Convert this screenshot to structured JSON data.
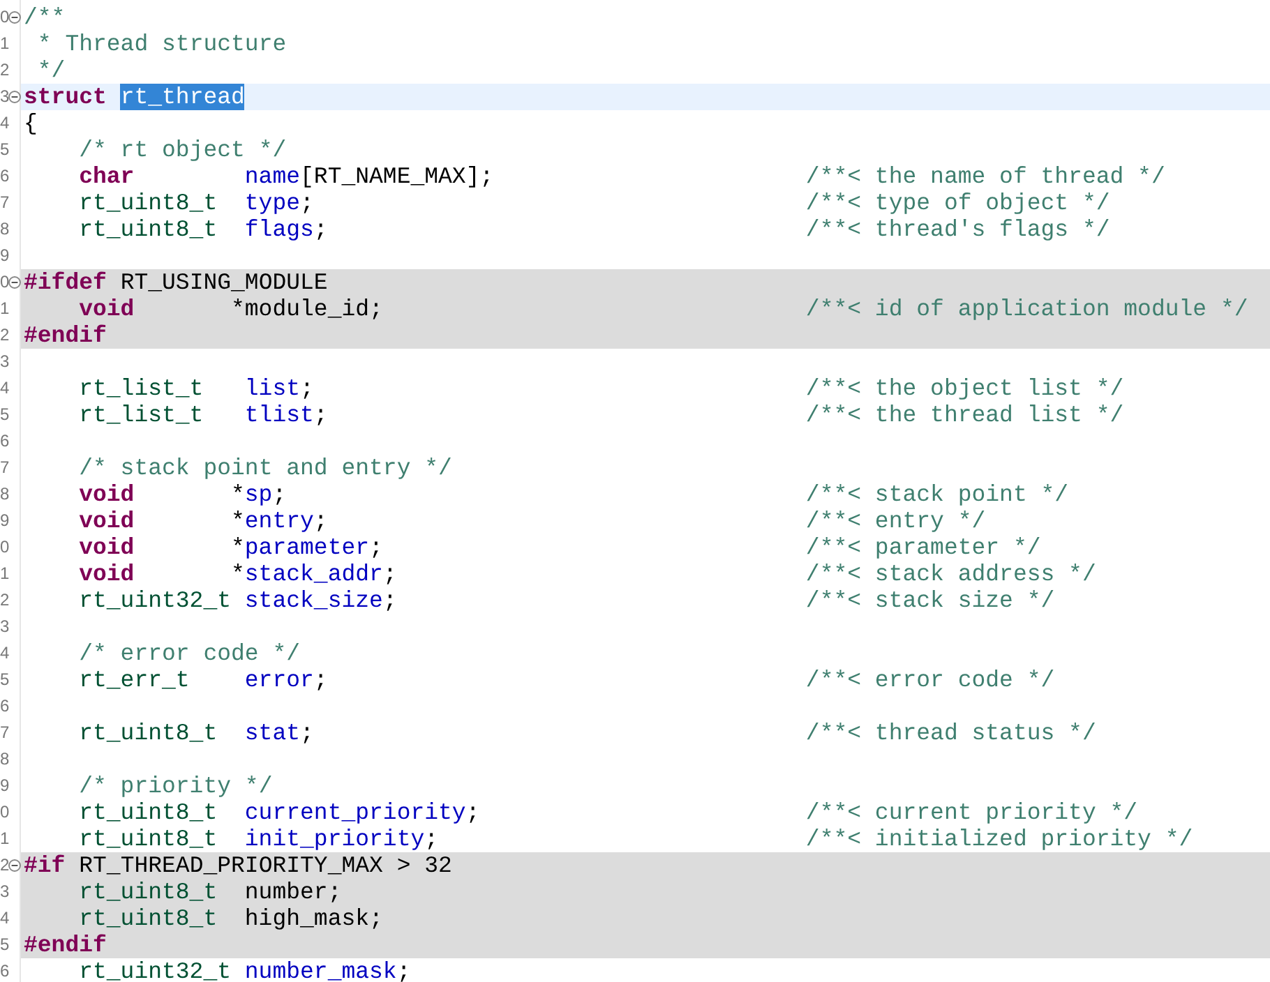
{
  "editor": {
    "lines": [
      {
        "number": "0",
        "kind": "code",
        "indent": false,
        "fold": true,
        "inactive": false,
        "current": false,
        "tokens": [
          {
            "kind": "comment",
            "text": "/**"
          }
        ]
      },
      {
        "number": "1",
        "kind": "code",
        "indent": false,
        "fold": false,
        "inactive": false,
        "current": false,
        "tokens": [
          {
            "kind": "comment",
            "text": " * Thread structure"
          }
        ]
      },
      {
        "number": "2",
        "kind": "code",
        "indent": false,
        "fold": false,
        "inactive": false,
        "current": false,
        "tokens": [
          {
            "kind": "comment",
            "text": " */"
          }
        ]
      },
      {
        "number": "3",
        "kind": "code",
        "indent": false,
        "fold": true,
        "inactive": false,
        "current": true,
        "tokens": [
          {
            "kind": "keyword",
            "text": "struct"
          },
          {
            "kind": "plain",
            "text": "rt_thread",
            "selected": true
          }
        ]
      },
      {
        "number": "4",
        "kind": "code",
        "indent": false,
        "fold": false,
        "inactive": false,
        "current": false,
        "tokens": [
          {
            "kind": "plain",
            "text": "{"
          }
        ]
      },
      {
        "number": "5",
        "kind": "code",
        "indent": true,
        "fold": false,
        "inactive": false,
        "current": false,
        "tokens": [
          {
            "kind": "comment",
            "text": "/* rt object */"
          }
        ]
      },
      {
        "number": "6",
        "kind": "decl",
        "indent": true,
        "fold": false,
        "inactive": false,
        "current": false,
        "tokens": [
          {
            "kind": "keyword",
            "text": "char"
          },
          {
            "kind": "field",
            "text": "name"
          },
          {
            "kind": "punct",
            "text": "[RT_NAME_MAX];"
          }
        ],
        "note": "/**< the name of thread */"
      },
      {
        "number": "7",
        "kind": "decl",
        "indent": true,
        "fold": false,
        "inactive": false,
        "current": false,
        "tokens": [
          {
            "kind": "type",
            "text": "rt_uint8_t"
          },
          {
            "kind": "field",
            "text": "type"
          },
          {
            "kind": "punct",
            "text": ";"
          }
        ],
        "note": "/**< type of object */"
      },
      {
        "number": "8",
        "kind": "decl",
        "indent": true,
        "fold": false,
        "inactive": false,
        "current": false,
        "tokens": [
          {
            "kind": "type",
            "text": "rt_uint8_t"
          },
          {
            "kind": "field",
            "text": "flags"
          },
          {
            "kind": "punct",
            "text": ";"
          }
        ],
        "note": "/**< thread's flags */"
      },
      {
        "number": "9",
        "kind": "blank",
        "fold": false,
        "inactive": false,
        "current": false
      },
      {
        "number": "0",
        "kind": "code",
        "indent": false,
        "fold": true,
        "inactive": true,
        "current": false,
        "tokens": [
          {
            "kind": "keyword",
            "text": "#ifdef"
          },
          {
            "kind": "plain",
            "text": "RT_USING_MODULE"
          }
        ]
      },
      {
        "number": "1",
        "kind": "decl",
        "indent": true,
        "fold": false,
        "inactive": true,
        "current": false,
        "tokens": [
          {
            "kind": "keyword",
            "text": "void"
          },
          {
            "kind": "ptr",
            "text": "*"
          },
          {
            "kind": "plain",
            "text": "module_id"
          },
          {
            "kind": "punct",
            "text": ";"
          }
        ],
        "note": "/**< id of application module */"
      },
      {
        "number": "2",
        "kind": "code",
        "indent": false,
        "fold": false,
        "inactive": true,
        "current": false,
        "tokens": [
          {
            "kind": "keyword",
            "text": "#endif"
          }
        ]
      },
      {
        "number": "3",
        "kind": "blank",
        "fold": false,
        "inactive": false,
        "current": false
      },
      {
        "number": "4",
        "kind": "decl",
        "indent": true,
        "fold": false,
        "inactive": false,
        "current": false,
        "tokens": [
          {
            "kind": "type",
            "text": "rt_list_t"
          },
          {
            "kind": "field",
            "text": "list"
          },
          {
            "kind": "punct",
            "text": ";"
          }
        ],
        "note": "/**< the object list */"
      },
      {
        "number": "5",
        "kind": "decl",
        "indent": true,
        "fold": false,
        "inactive": false,
        "current": false,
        "tokens": [
          {
            "kind": "type",
            "text": "rt_list_t"
          },
          {
            "kind": "field",
            "text": "tlist"
          },
          {
            "kind": "punct",
            "text": ";"
          }
        ],
        "note": "/**< the thread list */"
      },
      {
        "number": "6",
        "kind": "blank",
        "fold": false,
        "inactive": false,
        "current": false
      },
      {
        "number": "7",
        "kind": "code",
        "indent": true,
        "fold": false,
        "inactive": false,
        "current": false,
        "tokens": [
          {
            "kind": "comment",
            "text": "/* stack point and entry */"
          }
        ]
      },
      {
        "number": "8",
        "kind": "decl",
        "indent": true,
        "fold": false,
        "inactive": false,
        "current": false,
        "tokens": [
          {
            "kind": "keyword",
            "text": "void"
          },
          {
            "kind": "ptr",
            "text": "*"
          },
          {
            "kind": "field",
            "text": "sp"
          },
          {
            "kind": "punct",
            "text": ";"
          }
        ],
        "note": "/**< stack point */"
      },
      {
        "number": "9",
        "kind": "decl",
        "indent": true,
        "fold": false,
        "inactive": false,
        "current": false,
        "tokens": [
          {
            "kind": "keyword",
            "text": "void"
          },
          {
            "kind": "ptr",
            "text": "*"
          },
          {
            "kind": "field",
            "text": "entry"
          },
          {
            "kind": "punct",
            "text": ";"
          }
        ],
        "note": "/**< entry */"
      },
      {
        "number": "0",
        "kind": "decl",
        "indent": true,
        "fold": false,
        "inactive": false,
        "current": false,
        "tokens": [
          {
            "kind": "keyword",
            "text": "void"
          },
          {
            "kind": "ptr",
            "text": "*"
          },
          {
            "kind": "field",
            "text": "parameter"
          },
          {
            "kind": "punct",
            "text": ";"
          }
        ],
        "note": "/**< parameter */"
      },
      {
        "number": "1",
        "kind": "decl",
        "indent": true,
        "fold": false,
        "inactive": false,
        "current": false,
        "tokens": [
          {
            "kind": "keyword",
            "text": "void"
          },
          {
            "kind": "ptr",
            "text": "*"
          },
          {
            "kind": "field",
            "text": "stack_addr"
          },
          {
            "kind": "punct",
            "text": ";"
          }
        ],
        "note": "/**< stack address */"
      },
      {
        "number": "2",
        "kind": "decl",
        "indent": true,
        "fold": false,
        "inactive": false,
        "current": false,
        "tokens": [
          {
            "kind": "type",
            "text": "rt_uint32_t"
          },
          {
            "kind": "field",
            "text": "stack_size"
          },
          {
            "kind": "punct",
            "text": ";"
          }
        ],
        "note": "/**< stack size */"
      },
      {
        "number": "3",
        "kind": "blank",
        "fold": false,
        "inactive": false,
        "current": false
      },
      {
        "number": "4",
        "kind": "code",
        "indent": true,
        "fold": false,
        "inactive": false,
        "current": false,
        "tokens": [
          {
            "kind": "comment",
            "text": "/* error code */"
          }
        ]
      },
      {
        "number": "5",
        "kind": "decl",
        "indent": true,
        "fold": false,
        "inactive": false,
        "current": false,
        "tokens": [
          {
            "kind": "type",
            "text": "rt_err_t"
          },
          {
            "kind": "field",
            "text": "error"
          },
          {
            "kind": "punct",
            "text": ";"
          }
        ],
        "note": "/**< error code */"
      },
      {
        "number": "6",
        "kind": "blank",
        "fold": false,
        "inactive": false,
        "current": false
      },
      {
        "number": "7",
        "kind": "decl",
        "indent": true,
        "fold": false,
        "inactive": false,
        "current": false,
        "tokens": [
          {
            "kind": "type",
            "text": "rt_uint8_t"
          },
          {
            "kind": "field",
            "text": "stat"
          },
          {
            "kind": "punct",
            "text": ";"
          }
        ],
        "note": "/**< thread status */"
      },
      {
        "number": "8",
        "kind": "blank",
        "fold": false,
        "inactive": false,
        "current": false
      },
      {
        "number": "9",
        "kind": "code",
        "indent": true,
        "fold": false,
        "inactive": false,
        "current": false,
        "tokens": [
          {
            "kind": "comment",
            "text": "/* priority */"
          }
        ]
      },
      {
        "number": "0",
        "kind": "decl",
        "indent": true,
        "fold": false,
        "inactive": false,
        "current": false,
        "tokens": [
          {
            "kind": "type",
            "text": "rt_uint8_t"
          },
          {
            "kind": "field",
            "text": "current_priority"
          },
          {
            "kind": "punct",
            "text": ";"
          }
        ],
        "note": "/**< current priority */"
      },
      {
        "number": "1",
        "kind": "decl",
        "indent": true,
        "fold": false,
        "inactive": false,
        "current": false,
        "tokens": [
          {
            "kind": "type",
            "text": "rt_uint8_t"
          },
          {
            "kind": "field",
            "text": "init_priority"
          },
          {
            "kind": "punct",
            "text": ";"
          }
        ],
        "note": "/**< initialized priority */"
      },
      {
        "number": "2",
        "kind": "code",
        "indent": false,
        "fold": true,
        "inactive": true,
        "current": false,
        "tokens": [
          {
            "kind": "keyword",
            "text": "#if"
          },
          {
            "kind": "plain",
            "text": "RT_THREAD_PRIORITY_MAX > 32"
          }
        ]
      },
      {
        "number": "3",
        "kind": "decl",
        "indent": true,
        "fold": false,
        "inactive": true,
        "current": false,
        "tokens": [
          {
            "kind": "type",
            "text": "rt_uint8_t"
          },
          {
            "kind": "plain",
            "text": "number"
          },
          {
            "kind": "punct",
            "text": ";"
          }
        ]
      },
      {
        "number": "4",
        "kind": "decl",
        "indent": true,
        "fold": false,
        "inactive": true,
        "current": false,
        "tokens": [
          {
            "kind": "type",
            "text": "rt_uint8_t"
          },
          {
            "kind": "plain",
            "text": "high_mask"
          },
          {
            "kind": "punct",
            "text": ";"
          }
        ]
      },
      {
        "number": "5",
        "kind": "code",
        "indent": false,
        "fold": false,
        "inactive": true,
        "current": false,
        "tokens": [
          {
            "kind": "keyword",
            "text": "#endif"
          }
        ]
      },
      {
        "number": "6",
        "kind": "decl",
        "indent": true,
        "fold": false,
        "inactive": false,
        "current": false,
        "tokens": [
          {
            "kind": "type",
            "text": "rt_uint32_t"
          },
          {
            "kind": "field",
            "text": "number_mask"
          },
          {
            "kind": "punct",
            "text": ";"
          }
        ]
      }
    ]
  }
}
